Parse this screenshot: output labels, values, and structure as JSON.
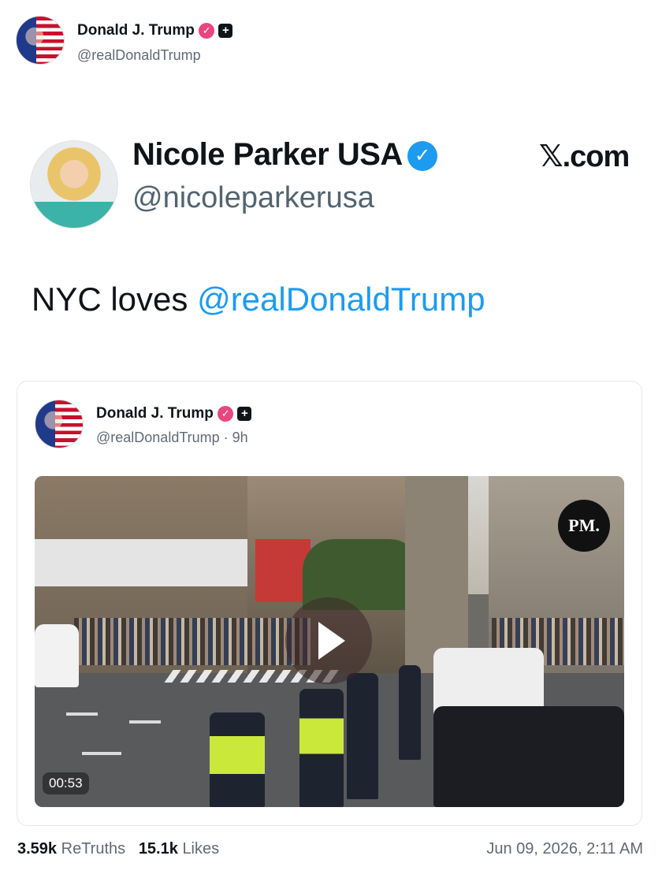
{
  "post": {
    "author_name": "Donald J. Trump",
    "author_handle": "@realDonaldTrump"
  },
  "quoted_tweet": {
    "name": "Nicole Parker USA",
    "handle": "@nicoleparkerusa",
    "source": "𝕏.com",
    "text": "NYC loves ",
    "mention": "@realDonaldTrump"
  },
  "embed": {
    "author_name": "Donald J. Trump",
    "author_handle": "@realDonaldTrump · 9h",
    "video": {
      "badge": "PM.",
      "duration": "00:53"
    }
  },
  "footer": {
    "retruths_count": "3.59k",
    "retruths_label": "ReTruths",
    "likes_count": "15.1k",
    "likes_label": "Likes",
    "timestamp": "Jun 09, 2026, 2:11 AM"
  },
  "icons": {
    "verified": "verified-badge-icon",
    "plus": "plus-badge-icon",
    "blue_check": "blue-check-icon",
    "play": "play-icon"
  },
  "colors": {
    "mention": "#1d9bf0",
    "verified_pink": "#e8477d",
    "muted": "#606a76"
  }
}
